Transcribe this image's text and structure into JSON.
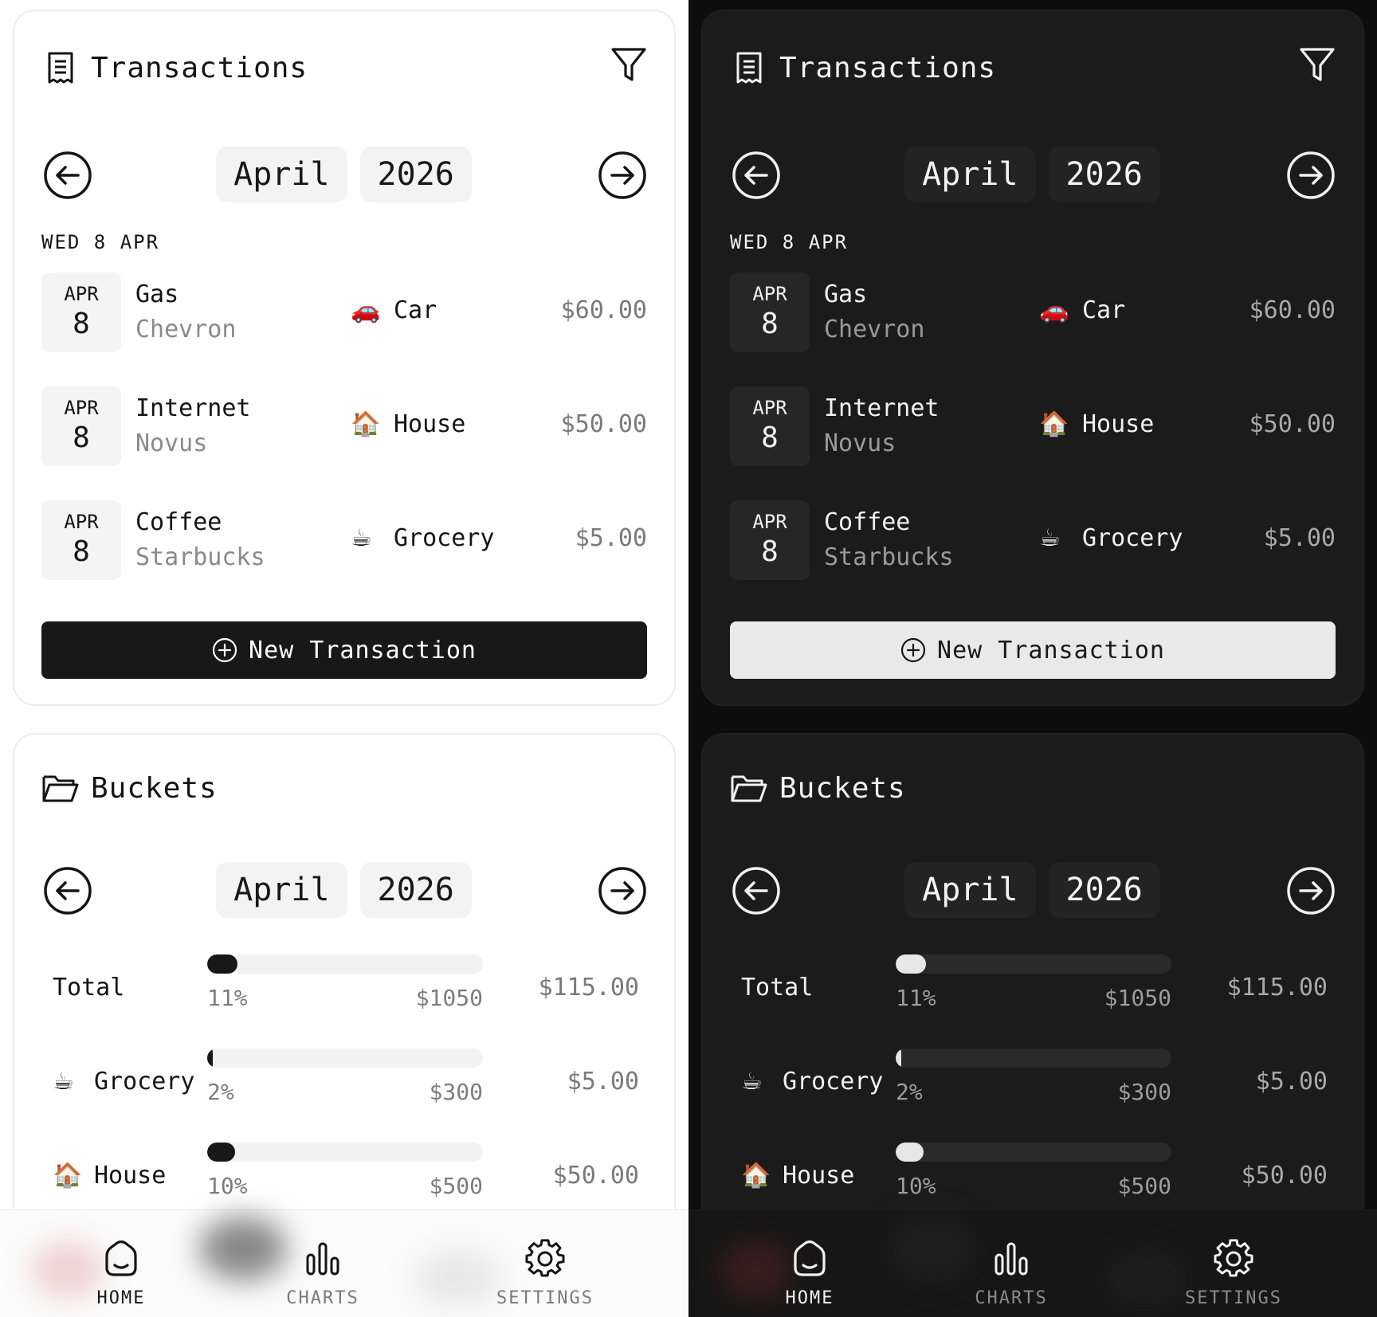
{
  "transactions": {
    "title": "Transactions",
    "month": "April",
    "year": "2026",
    "day_label": "WED 8 APR",
    "items": [
      {
        "month": "APR",
        "day": "8",
        "name": "Gas",
        "merchant": "Chevron",
        "category_emoji": "🚗",
        "category": "Car",
        "amount": "$60.00"
      },
      {
        "month": "APR",
        "day": "8",
        "name": "Internet",
        "merchant": "Novus",
        "category_emoji": "🏠",
        "category": "House",
        "amount": "$50.00"
      },
      {
        "month": "APR",
        "day": "8",
        "name": "Coffee",
        "merchant": "Starbucks",
        "category_emoji": "☕",
        "category": "Grocery",
        "amount": "$5.00"
      }
    ],
    "new_button_label": "New Transaction"
  },
  "buckets": {
    "title": "Buckets",
    "month": "April",
    "year": "2026",
    "items": [
      {
        "emoji": "",
        "name": "Total",
        "fraction": 0.11,
        "percent_label": "11%",
        "limit": "$1050",
        "amount": "$115.00"
      },
      {
        "emoji": "☕",
        "name": "Grocery",
        "fraction": 0.02,
        "percent_label": "2%",
        "limit": "$300",
        "amount": "$5.00"
      },
      {
        "emoji": "🏠",
        "name": "House",
        "fraction": 0.1,
        "percent_label": "10%",
        "limit": "$500",
        "amount": "$50.00"
      }
    ]
  },
  "nav": {
    "items": [
      {
        "id": "home",
        "label": "HOME",
        "icon": "home-icon",
        "active": true
      },
      {
        "id": "charts",
        "label": "CHARTS",
        "icon": "bar-chart-icon",
        "active": false
      },
      {
        "id": "settings",
        "label": "SETTINGS",
        "icon": "gear-icon",
        "active": false
      }
    ]
  },
  "themes": {
    "light": {
      "background": "#ffffff",
      "text": "#141414",
      "accent": "#181818"
    },
    "dark": {
      "background": "#0d0d0d",
      "text": "#f1f1f1",
      "accent": "#e9e9e9"
    }
  }
}
